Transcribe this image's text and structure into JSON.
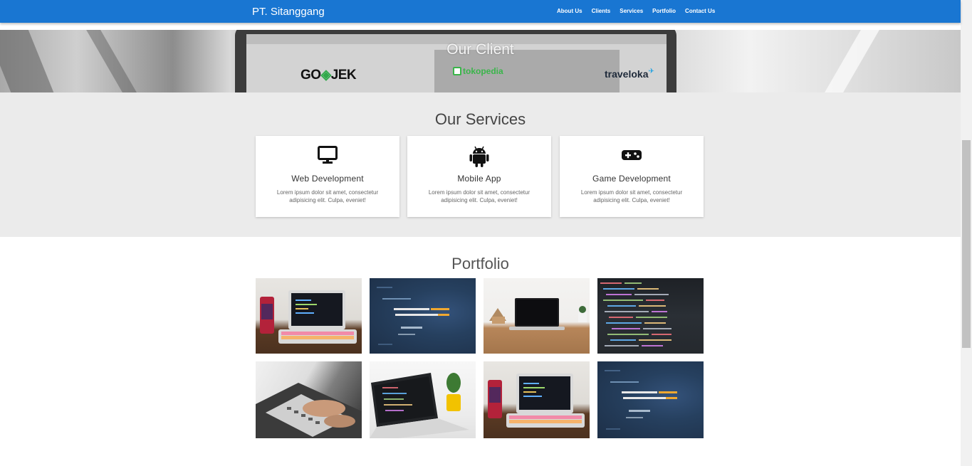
{
  "navbar": {
    "brand": "PT. Sitanggang",
    "links": [
      "About Us",
      "Clients",
      "Services",
      "Portfolio",
      "Contact Us"
    ]
  },
  "clients": {
    "title": "Our Client",
    "logos": [
      {
        "name": "gojek-logo",
        "text_a": "GO",
        "text_b": "JEK"
      },
      {
        "name": "tokopedia-logo",
        "text": "tokopedia"
      },
      {
        "name": "traveloka-logo",
        "text": "traveloka"
      }
    ]
  },
  "services": {
    "title": "Our Services",
    "cards": [
      {
        "icon": "monitor-icon",
        "title": "Web Development",
        "desc": "Lorem ipsum dolor sit amet, consectetur adipisicing elit. Culpa, eveniet!"
      },
      {
        "icon": "android-icon",
        "title": "Mobile App",
        "desc": "Lorem ipsum dolor sit amet, consectetur adipisicing elit. Culpa, eveniet!"
      },
      {
        "icon": "gamepad-icon",
        "title": "Game Development",
        "desc": "Lorem ipsum dolor sit amet, consectetur adipisicing elit. Culpa, eveniet!"
      }
    ]
  },
  "portfolio": {
    "title": "Portfolio"
  },
  "colors": {
    "navbar": "#1976d2",
    "services_bg": "#ebebeb"
  }
}
